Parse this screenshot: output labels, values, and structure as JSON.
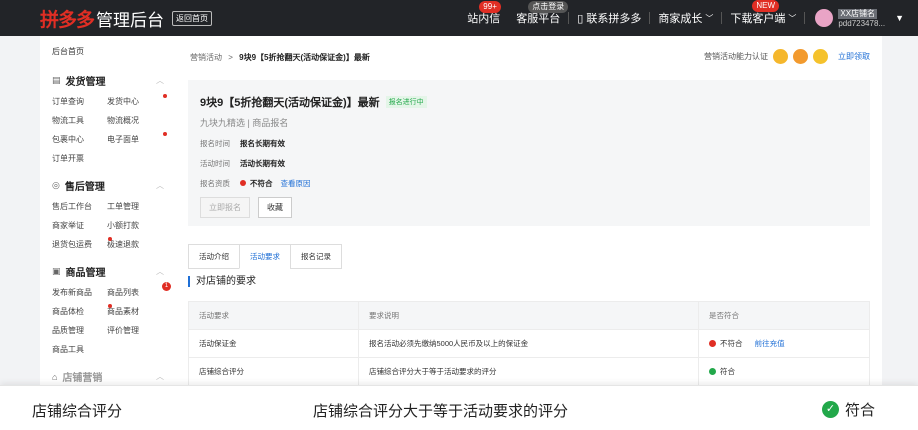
{
  "topbar": {
    "logo_brand": "拼多多",
    "logo_admin": "管理后台",
    "back_home": "返回首页",
    "links": {
      "messages": "站内信",
      "messages_badge": "99+",
      "service": "客服平台",
      "service_badge": "点击登录",
      "contact": "联系拼多多",
      "growth": "商家成长",
      "download": "下载客户端",
      "download_badge": "NEW"
    },
    "store_name": "XX店铺名",
    "store_id": "pdd723478..."
  },
  "sidebar": {
    "home": "后台首页",
    "sections": {
      "shipping": {
        "title": "发货管理",
        "items": [
          "订单查询",
          "发货中心",
          "物流工具",
          "物流概况",
          "包裹中心",
          "电子面单",
          "订单开票"
        ]
      },
      "aftersale": {
        "title": "售后管理",
        "items": [
          "售后工作台",
          "工单管理",
          "商家举证",
          "小额打款",
          "退货包运费",
          "极速退款"
        ]
      },
      "goods": {
        "title": "商品管理",
        "items": [
          "发布新商品",
          "商品列表",
          "商品体检",
          "商品素材",
          "品质管理",
          "评价管理",
          "商品工具"
        ],
        "list_badge": "1"
      },
      "marketing": {
        "title": "店铺营销"
      }
    }
  },
  "main": {
    "breadcrumb_root": "营销活动",
    "breadcrumb_sep": ">",
    "breadcrumb_current": "9块9【5折抢翻天(活动保证金)】最新",
    "cert_label": "营销活动能力认证",
    "cert_link": "立即领取",
    "activity_title": "9块9【5折抢翻天(活动保证金)】最新",
    "status_tag": "报名进行中",
    "subtitle": "九块九精选 | 商品报名",
    "signup_time_label": "报名时间",
    "signup_time_value": "报名长期有效",
    "activity_time_label": "活动时间",
    "activity_time_value": "活动长期有效",
    "qualification_label": "报名资质",
    "qualification_value": "不符合",
    "qualification_link": "查看原因",
    "btn_signup": "立即报名",
    "btn_favorite": "收藏",
    "tabs": [
      "活动介绍",
      "活动要求",
      "报名记录"
    ],
    "section_title": "对店铺的要求",
    "table": {
      "headers": [
        "活动要求",
        "要求说明",
        "是否符合"
      ],
      "rows": [
        {
          "req": "活动保证金",
          "desc": "报名活动必须先缴纳5000人民币及以上的保证金",
          "status": "不符合",
          "action": "前往充值"
        },
        {
          "req": "店铺综合评分",
          "desc": "店铺综合评分大于等于活动要求的评分",
          "status": "符合"
        }
      ]
    }
  },
  "zoom": {
    "req": "店铺综合评分",
    "desc": "店铺综合评分大于等于活动要求的评分",
    "status": "符合"
  }
}
